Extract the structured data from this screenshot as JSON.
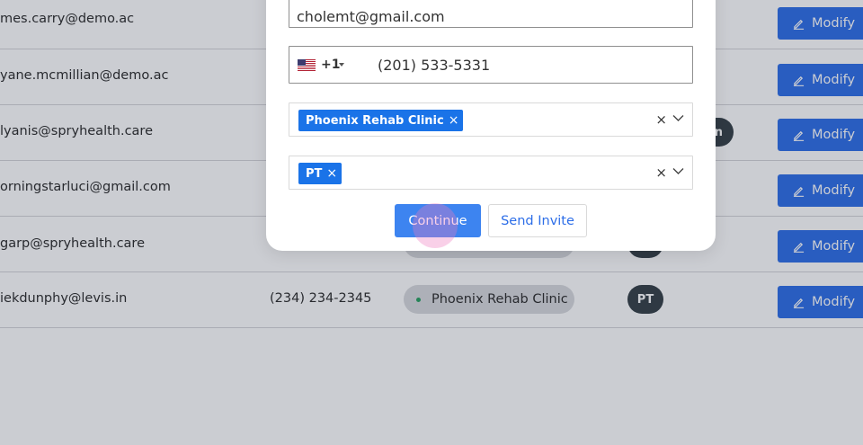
{
  "table": {
    "rows": [
      {
        "email": "mes.carry@demo.ac",
        "modify_label": "Modify"
      },
      {
        "email": "yane.mcmillian@demo.ac",
        "modify_label": "Modify"
      },
      {
        "email": "lyanis@spryhealth.care",
        "modify_label": "Modify"
      },
      {
        "email": "orningstarluci@gmail.com",
        "modify_label": "Modify"
      },
      {
        "email": "garp@spryhealth.care",
        "modify_label": "Modify"
      },
      {
        "email": "iekdunphy@levis.in",
        "phone": "(234) 234-2345",
        "clinic": "Phoenix Rehab Clinic",
        "role": "PT",
        "modify_label": "Modify"
      }
    ],
    "partial_badge_text": "n"
  },
  "modal": {
    "email_value": "cholemt@gmail.com",
    "phone": {
      "country_code": "+1",
      "number": "(201) 533-5331",
      "flag_icon": "us-flag-icon"
    },
    "clinic_select": {
      "tag": "Phoenix Rehab Clinic",
      "clear": "×"
    },
    "role_select": {
      "tag": "PT",
      "clear": "×"
    },
    "continue_label": "Continue",
    "send_invite_label": "Send Invite"
  },
  "colors": {
    "primary": "#2d6ee8",
    "tag": "#1a73e8",
    "badge": "#343f46"
  }
}
